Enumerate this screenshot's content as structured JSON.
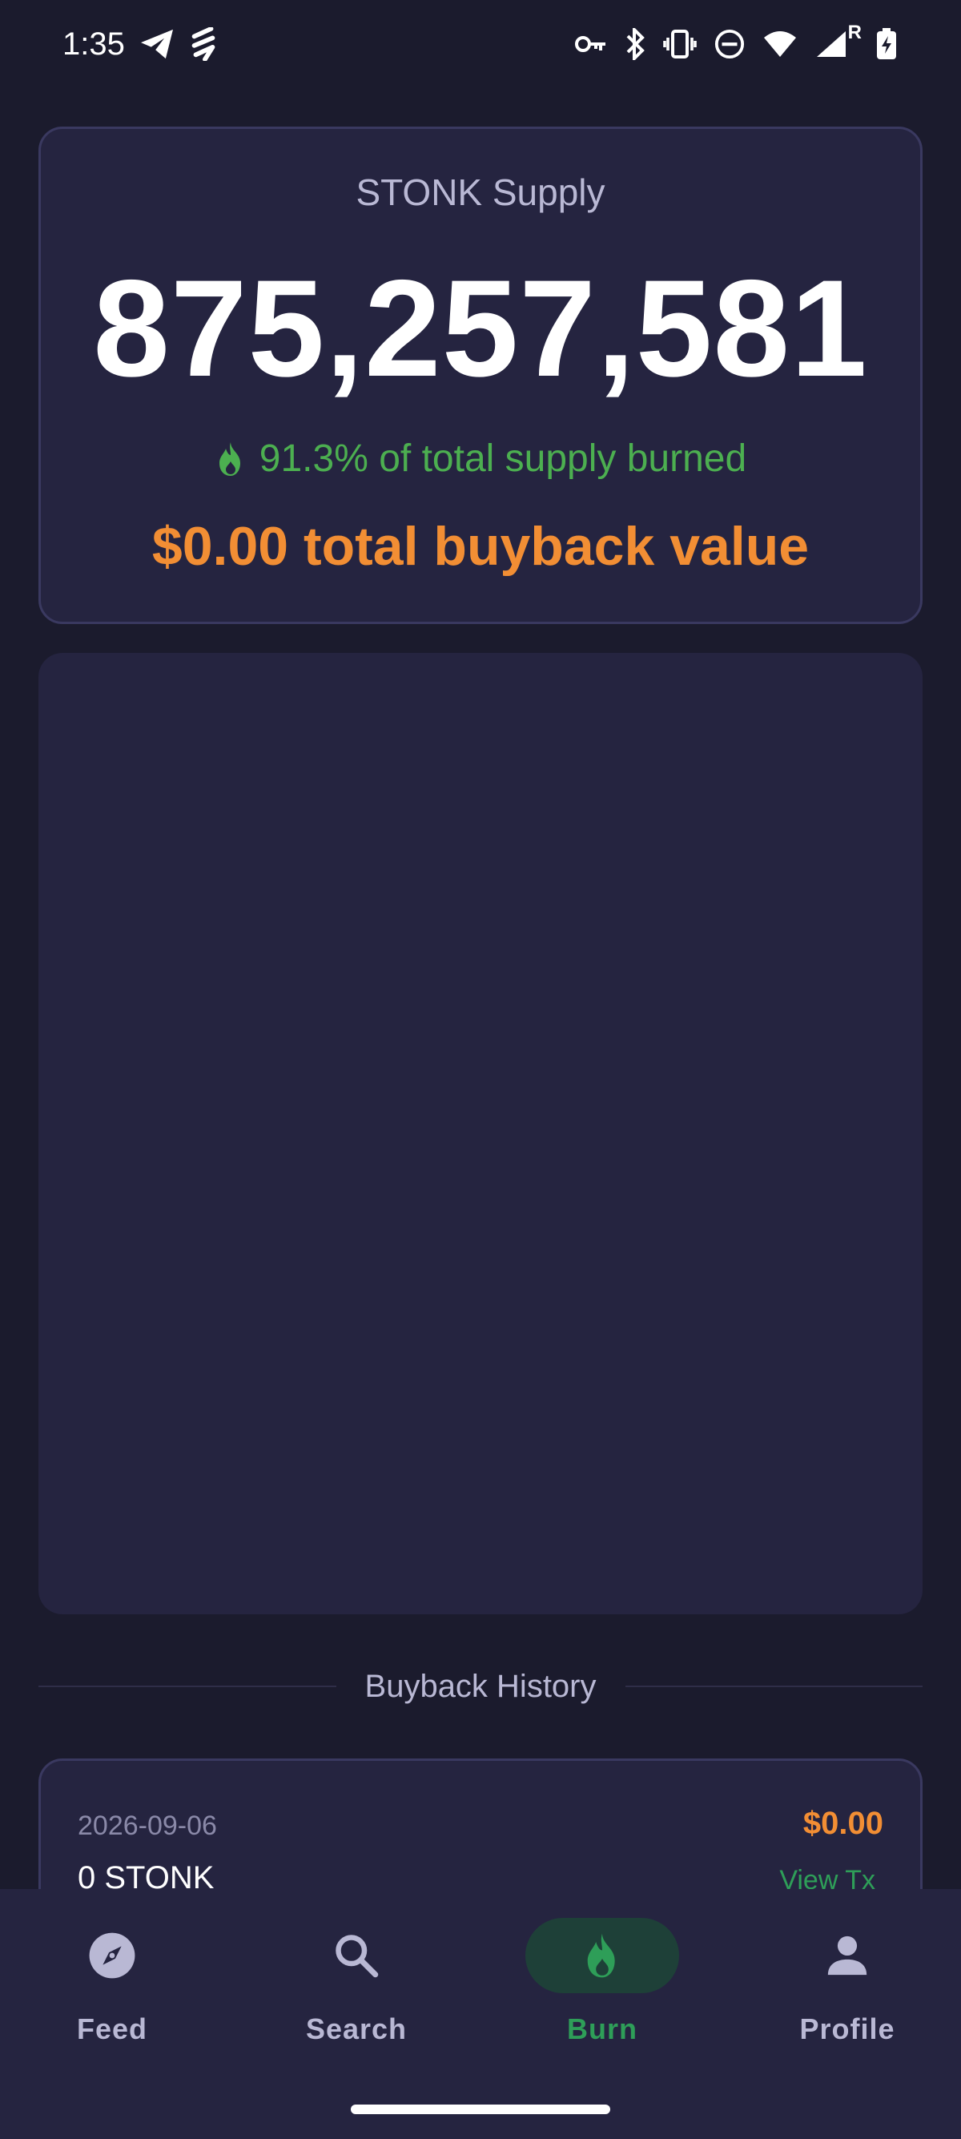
{
  "status_bar": {
    "time": "1:35",
    "left_icons": [
      "telegram-icon",
      "flash-icon"
    ],
    "right_icons": [
      "key-icon",
      "bluetooth-icon",
      "vibrate-icon",
      "dnd-icon",
      "wifi-icon",
      "signal-icon",
      "battery-charging-icon"
    ],
    "roaming_label": "R"
  },
  "supply": {
    "title": "STONK Supply",
    "value": "875,257,581",
    "burned_text": "91.3% of total supply burned",
    "buyback_text": "$0.00 total buyback value"
  },
  "history": {
    "title": "Buyback History",
    "items": [
      {
        "date": "2026-09-06",
        "amount": "0 STONK",
        "value": "$0.00",
        "link": "View Tx"
      }
    ]
  },
  "nav": {
    "items": [
      {
        "label": "Feed",
        "icon": "compass-icon",
        "active": false
      },
      {
        "label": "Search",
        "icon": "search-icon",
        "active": false
      },
      {
        "label": "Burn",
        "icon": "flame-icon",
        "active": true
      },
      {
        "label": "Profile",
        "icon": "person-icon",
        "active": false
      }
    ]
  },
  "colors": {
    "background": "#1b1b2d",
    "card": "#252440",
    "accent_green": "#4caf50",
    "accent_orange": "#f28e34",
    "active_green": "#2e9e58"
  }
}
